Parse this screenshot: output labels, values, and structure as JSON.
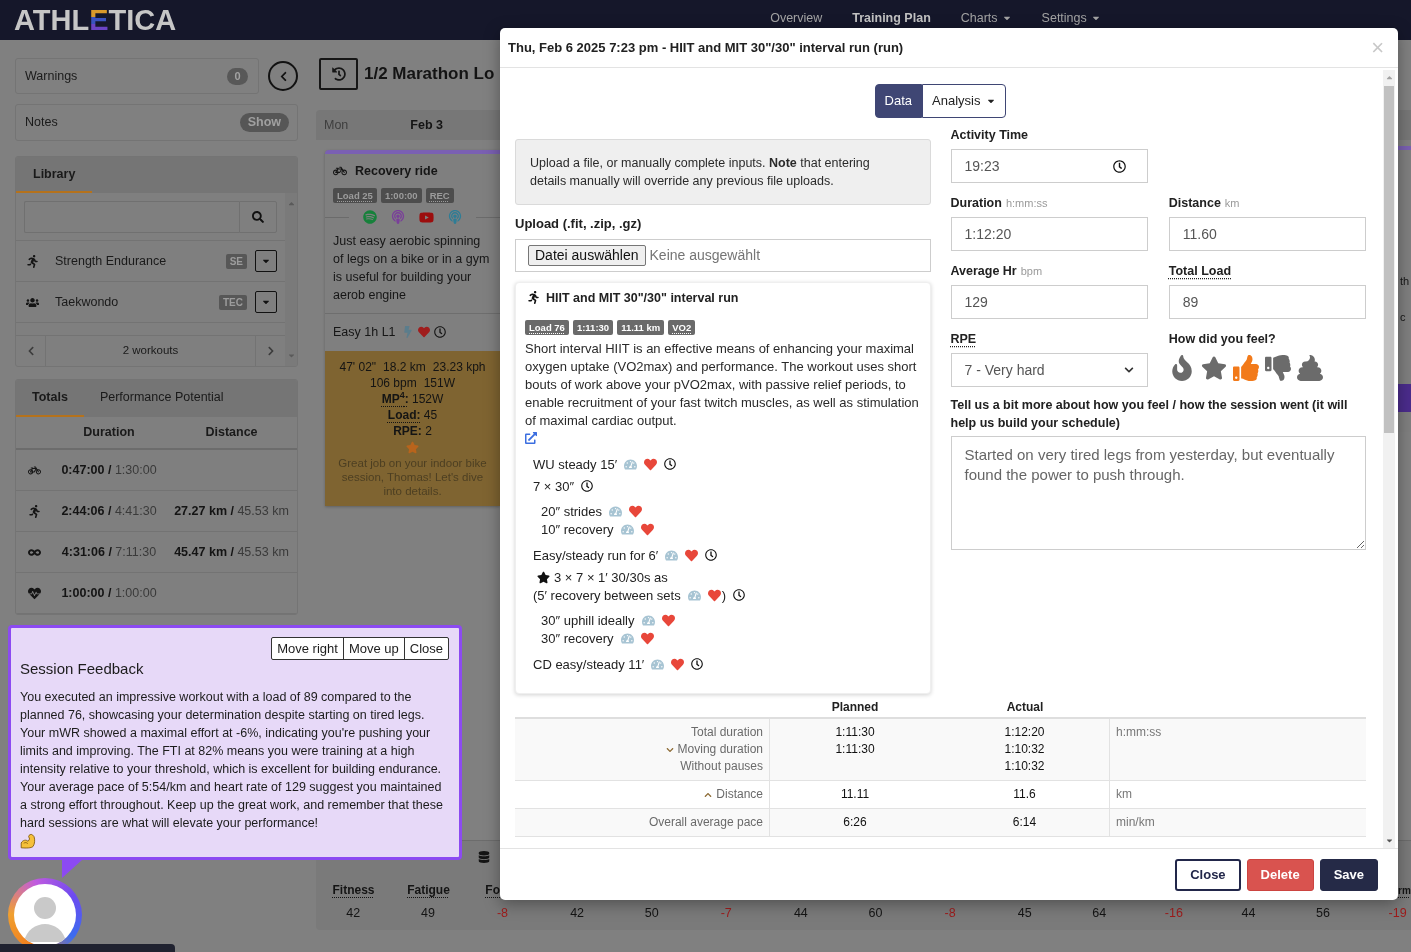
{
  "nav": {
    "logo": [
      {
        "text": "ATHL",
        "kind": "plain"
      },
      {
        "text": "E",
        "kind": "striped"
      },
      {
        "text": "TICA",
        "kind": "plain"
      }
    ],
    "items": [
      {
        "label": "Overview",
        "selected": false,
        "dropdown": false
      },
      {
        "label": "Training Plan",
        "selected": true,
        "dropdown": false
      },
      {
        "label": "Charts",
        "selected": false,
        "dropdown": true
      },
      {
        "label": "Settings",
        "selected": false,
        "dropdown": true
      }
    ]
  },
  "sidebar": {
    "warnings": {
      "label": "Warnings",
      "count": "0"
    },
    "notes": {
      "label": "Notes",
      "action": "Show"
    },
    "library": {
      "tabs": [
        {
          "label": "Library",
          "selected": true
        }
      ],
      "items": [
        {
          "kind": "run",
          "name": "Strength Endurance",
          "tag": "SE"
        },
        {
          "kind": "group",
          "name": "Taekwondo",
          "tag": "TEC"
        }
      ],
      "pager": "2 workouts"
    },
    "totals": {
      "tabs": [
        {
          "label": "Totals",
          "selected": true
        },
        {
          "label": "Performance Potential",
          "selected": false
        }
      ],
      "columns": [
        "Duration",
        "Distance"
      ],
      "rows": [
        {
          "kind": "bike",
          "duration": "**0:47:00 /** 1:30:00"
        },
        {
          "kind": "run",
          "duration": "**2:44:06 /** 4:41:30",
          "distance": "**27.27 km /** 45.53 km"
        },
        {
          "kind": "all",
          "duration": "**4:31:06 /** 7:11:30",
          "distance": "**45.47 km /** 45.53 km"
        },
        {
          "kind": "heart",
          "duration": "**1:00:00 /** 1:00:00"
        }
      ]
    }
  },
  "plan": {
    "title": "1/2 Marathon Lo",
    "day": {
      "weekday": "Mon",
      "date": "Feb 3"
    },
    "card": {
      "kind": "bike",
      "title": "Recovery ride",
      "badges": [
        {
          "text": "Load 25",
          "dotted": true
        },
        {
          "text": "1:00:00",
          "dotted": false
        },
        {
          "text": "REC",
          "dotted": true
        }
      ],
      "description": "Just easy aerobic spinning of legs on a bike or in a gym is useful for building your aerob engine",
      "session": {
        "text": "Easy 1h L1",
        "power": true,
        "hr": true,
        "time": true
      },
      "result": {
        "metrics": [
          [
            "47' 02\"",
            "18.2 km",
            "23.23 kph"
          ],
          [
            "106 bpm",
            "151W"
          ]
        ],
        "values": [
          {
            "label": "MP$^{4}$:",
            "value": "152W",
            "dotted": true
          },
          {
            "label": "Load:",
            "value": "45",
            "dotted": true
          },
          {
            "label": "RPE:",
            "value": "2",
            "dotted": false
          }
        ],
        "comment": "Great job on your indoor bike session, Thomas! Let's dive into details."
      }
    }
  },
  "stats": {
    "cells": [
      {
        "label": "Fitness",
        "value": "42",
        "color": "#141414"
      },
      {
        "label": "Fatigue",
        "value": "49",
        "color": "#141414"
      },
      {
        "label": "Fo",
        "value": "-8",
        "color": "#9e1b1b"
      },
      {
        "value": "42",
        "color": "#141414"
      },
      {
        "value": "50",
        "color": "#141414"
      },
      {
        "value": "-7",
        "color": "#9e1b1b"
      },
      {
        "value": "44",
        "color": "#141414"
      },
      {
        "value": "60",
        "color": "#141414"
      },
      {
        "value": "-8",
        "color": "#9e1b1b"
      },
      {
        "value": "45",
        "color": "#141414"
      },
      {
        "value": "64",
        "color": "#141414"
      },
      {
        "value": "-16",
        "color": "#9e1b1b"
      },
      {
        "value": "44",
        "color": "#141414"
      },
      {
        "value": "56",
        "color": "#141414"
      },
      {
        "label": "rm",
        "value": "-19",
        "color": "#9e1b1b"
      }
    ]
  },
  "right_edge": {
    "fragments": [
      "th",
      "c"
    ]
  },
  "modal": {
    "title": "Thu, Feb 6 2025 7:23 pm - HIIT and MIT 30\"/30\" interval run (run)",
    "close": "×",
    "tabs": [
      {
        "label": "Data",
        "selected": true,
        "dropdown": false
      },
      {
        "label": "Analysis",
        "selected": false,
        "dropdown": true
      }
    ],
    "info": "Upload a file, or manually complete inputs. **Note** that entering details manually will override any previous file uploads.",
    "upload": {
      "label": "Upload (.fit, .zip, .gz)",
      "button": "Datei auswählen",
      "status": "Keine ausgewählt"
    },
    "workout": {
      "kind": "run",
      "title": "HIIT and MIT 30\"/30\" interval run",
      "badges": [
        {
          "text": "Load 76",
          "dotted": true
        },
        {
          "text": "1:11:30",
          "dotted": false
        },
        {
          "text": "11.11 km",
          "dotted": false
        },
        {
          "text": "VO2",
          "dotted": true
        }
      ],
      "description": "Short interval HIIT is an effective means of enhancing your maximal oxygen uptake (VO2max) and performance. The workout uses short bouts of work above your pVO2max, with passive relief periods, to enable recruitment of your fast twitch muscles, as well as stimulation of maximal cardiac output.",
      "steps": [
        {
          "lines": [
            {
              "text": "WU steady 15′",
              "pace": true,
              "hr": true,
              "time": true
            }
          ]
        },
        {
          "lines": [
            {
              "text": "7 × 30″",
              "time": true
            }
          ],
          "children": [
            {
              "text": "20″ strides",
              "pace": true,
              "hr": true
            },
            {
              "text": "10″ recovery",
              "pace": true,
              "hr": true
            }
          ]
        },
        {
          "lines": [
            {
              "text": "Easy/steady run for 6′",
              "pace": true,
              "hr": true,
              "time": true
            }
          ]
        },
        {
          "lines": [
            {
              "text": "3 × 7 × 1′ 30/30s as",
              "starred": true
            },
            {
              "text": "(5′ recovery between sets",
              "pace": true,
              "hr": true,
              "closing": ")",
              "time": true
            }
          ],
          "children": [
            {
              "text": "30″ uphill ideally",
              "pace": true,
              "hr": true
            },
            {
              "text": "30″ recovery",
              "pace": true,
              "hr": true
            }
          ]
        },
        {
          "lines": [
            {
              "text": "CD easy/steady 11′",
              "pace": true,
              "hr": true,
              "time": true
            }
          ]
        }
      ]
    },
    "fields": [
      {
        "kind": "time",
        "label": "Activity Time",
        "value": "19:23"
      },
      {
        "kind": "text",
        "label": "Duration",
        "unit": "h:mm:ss",
        "value": "1:12:20"
      },
      {
        "kind": "text",
        "label": "Distance",
        "unit": "km",
        "value": "11.60"
      },
      {
        "kind": "text",
        "label": "Average Hr",
        "unit": "bpm",
        "value": "129"
      },
      {
        "kind": "text",
        "label": "Total Load",
        "dotted": true,
        "value": "89"
      },
      {
        "kind": "select",
        "label": "RPE",
        "dotted": true,
        "value": "7 - Very hard"
      }
    ],
    "feel": {
      "label": "How did you feel?",
      "options": [
        {
          "kind": "fire",
          "selected": false
        },
        {
          "kind": "star",
          "selected": false
        },
        {
          "kind": "thumbs_up",
          "selected": true
        },
        {
          "kind": "thumbs_down",
          "selected": false
        },
        {
          "kind": "poop",
          "selected": false
        }
      ]
    },
    "comment": {
      "label": "Tell us a bit more about how you feel / how the session went (it will help us build your schedule)",
      "value": "Started on very tired legs from yesterday, but eventually found the power to push through."
    },
    "summary": {
      "columns": [
        "Planned",
        "Actual"
      ],
      "rows": [
        {
          "labels": [
            {
              "text": "Total duration"
            },
            {
              "text": "Moving duration",
              "expanded": false
            },
            {
              "text": "Without pauses"
            }
          ],
          "planned": [
            "1:11:30",
            "1:11:30"
          ],
          "actual": [
            "1:12:20",
            "1:10:32",
            "1:10:32"
          ],
          "unit": "h:mm:ss"
        },
        {
          "labels": [
            {
              "text": "Distance",
              "expanded": true
            }
          ],
          "planned": [
            "11.11"
          ],
          "actual": [
            "11.6"
          ],
          "unit": "km"
        },
        {
          "labels": [
            {
              "text": "Overall average pace"
            }
          ],
          "planned": [
            "6:26"
          ],
          "actual": [
            "6:14"
          ],
          "unit": "min/km"
        }
      ]
    },
    "footer": [
      {
        "label": "Close",
        "kind": "outline"
      },
      {
        "label": "Delete",
        "kind": "danger"
      },
      {
        "label": "Save",
        "kind": "primary"
      }
    ]
  },
  "popup": {
    "buttons": [
      "Move right",
      "Move up",
      "Close"
    ],
    "title": "Session Feedback",
    "text": "You executed an impressive workout with a load of 89 compared to the planned 76, showcasing your determination despite starting on tired legs. Your mWR showed a maximal effort at -6%, indicating you're pushing your limits and improving. The FTI at 82% means you were training at a high intensity relative to your threshold, which is excellent for building endurance. Your average pace of 5:54/km and heart rate of 129 suggest you maintained a strong effort throughout. Keep up the great work, and remember that these hard sessions are what will elevate your performance!"
  }
}
